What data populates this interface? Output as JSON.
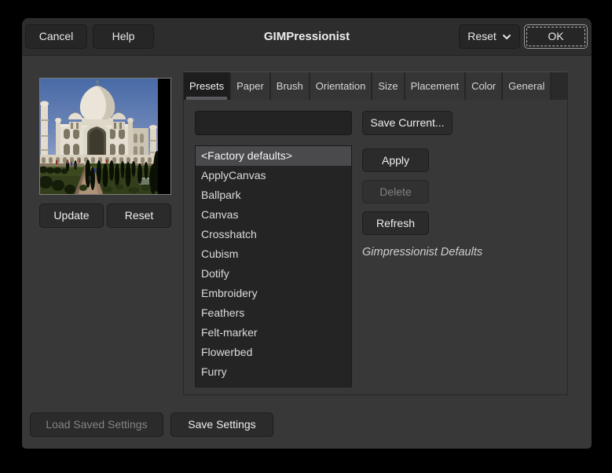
{
  "window": {
    "title": "GIMPressionist",
    "cancel_label": "Cancel",
    "help_label": "Help",
    "reset_menu_label": "Reset",
    "ok_label": "OK"
  },
  "preview": {
    "image_alt": "taj-mahal-preview",
    "update_label": "Update",
    "reset_label": "Reset"
  },
  "tabs": {
    "active": "Presets",
    "items": [
      "Presets",
      "Paper",
      "Brush",
      "Orientation",
      "Size",
      "Placement",
      "Color",
      "General"
    ]
  },
  "presets": {
    "name_entry_value": "",
    "save_current_label": "Save Current...",
    "list_items": [
      "<Factory defaults>",
      "ApplyCanvas",
      "Ballpark",
      "Canvas",
      "Crosshatch",
      "Cubism",
      "Dotify",
      "Embroidery",
      "Feathers",
      "Felt-marker",
      "Flowerbed",
      "Furry"
    ],
    "selected_item": "<Factory defaults>",
    "apply_label": "Apply",
    "delete_label": "Delete",
    "refresh_label": "Refresh",
    "description": "Gimpressionist Defaults"
  },
  "footer": {
    "load_saved_label": "Load Saved Settings",
    "save_settings_label": "Save Settings"
  },
  "colors": {
    "dialog_bg": "#383838",
    "header_bg": "#2d2d2d",
    "button_bg": "#2b2b2b",
    "list_bg": "#242424",
    "selected_row_bg": "#4a4a4d",
    "active_tab_bg": "#1d1d1d"
  }
}
